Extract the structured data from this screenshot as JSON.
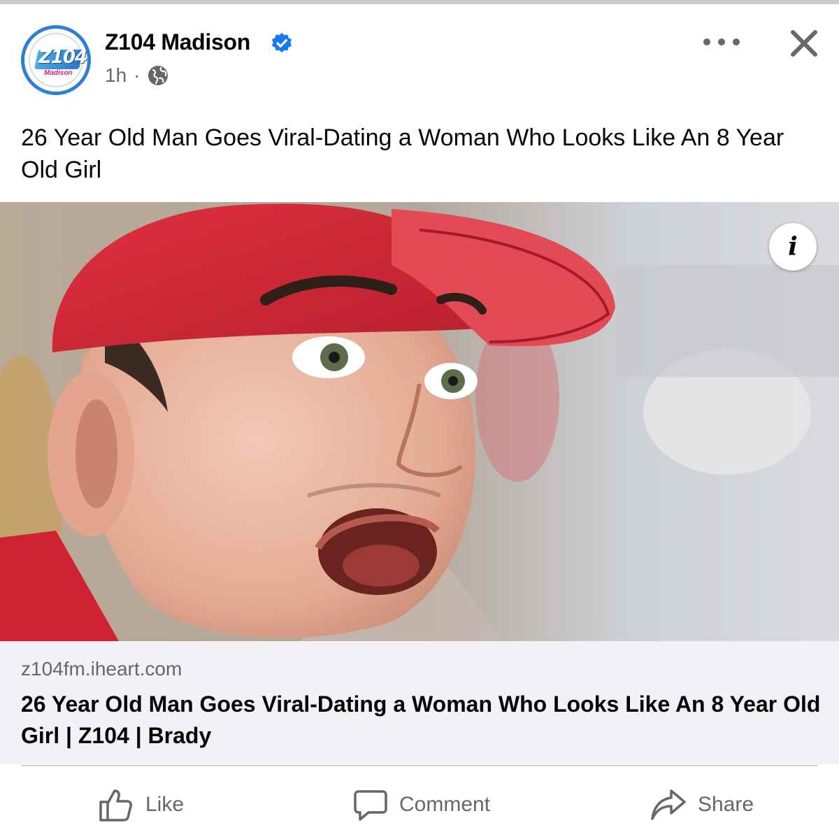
{
  "post": {
    "page_name": "Z104 Madison",
    "time": "1h",
    "separator": "·",
    "audience_icon": "globe-icon",
    "text": "26 Year Old Man Goes Viral-Dating a Woman Who Looks Like An 8 Year Old Girl",
    "avatar": {
      "logo_text": "Z104",
      "logo_sub": "Madison"
    }
  },
  "link": {
    "domain": "z104fm.iheart.com",
    "title": "26 Year Old Man Goes Viral-Dating a Woman Who Looks Like An 8 Year Old Girl | Z104 | Brady"
  },
  "media": {
    "info_label": "i",
    "description_icon": "photo"
  },
  "actions": {
    "like": "Like",
    "comment": "Comment",
    "share": "Share"
  },
  "colors": {
    "verified": "#1877f2",
    "secondary_text": "#65676b",
    "link_bg": "#f0f2f5",
    "avatar_ring": "#2e7fd1",
    "cap_red": "#d7263d"
  }
}
